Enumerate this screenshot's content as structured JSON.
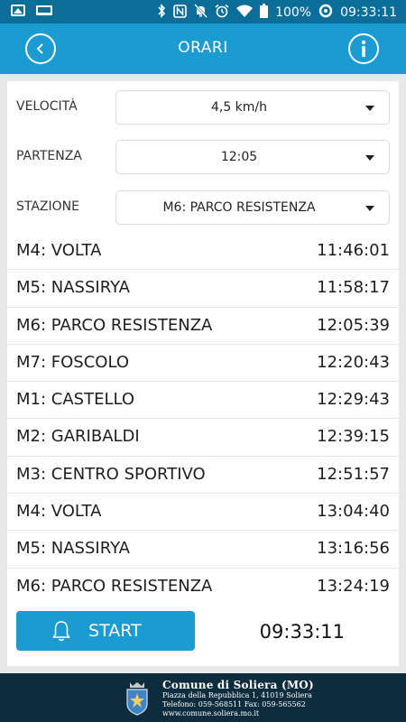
{
  "status_bar": {
    "battery": "100%",
    "time": "09:33:11",
    "left_icons": [
      "image-icon",
      "laptop-icon"
    ],
    "right_icons": [
      "bluetooth-icon",
      "nfc-icon",
      "mute-icon",
      "alarm-icon",
      "wifi-icon",
      "battery-icon",
      "data-saver-icon"
    ]
  },
  "appbar": {
    "title": "ORARI",
    "back_icon": "back-arrow-icon",
    "info_icon": "info-icon"
  },
  "form": {
    "speed_label": "VELOCITÀ",
    "speed_value": "4,5 km/h",
    "departure_label": "PARTENZA",
    "departure_value": "12:05",
    "station_label": "STAZIONE",
    "station_value": "M6: PARCO RESISTENZA"
  },
  "schedule": [
    {
      "stop": "M4: VOLTA",
      "time": "11:46:01"
    },
    {
      "stop": "M5: NASSIRYA",
      "time": "11:58:17"
    },
    {
      "stop": "M6: PARCO RESISTENZA",
      "time": "12:05:39"
    },
    {
      "stop": "M7: FOSCOLO",
      "time": "12:20:43"
    },
    {
      "stop": "M1: CASTELLO",
      "time": "12:29:43"
    },
    {
      "stop": "M2: GARIBALDI",
      "time": "12:39:15"
    },
    {
      "stop": "M3: CENTRO SPORTIVO",
      "time": "12:51:57"
    },
    {
      "stop": "M4: VOLTA",
      "time": "13:04:40"
    },
    {
      "stop": "M5: NASSIRYA",
      "time": "13:16:56"
    },
    {
      "stop": "M6: PARCO RESISTENZA",
      "time": "13:24:19"
    }
  ],
  "start_button": {
    "label": "START",
    "icon": "bell-icon"
  },
  "clock": "09:33:11",
  "footer": {
    "title": "Comune di Soliera (MO)",
    "address": "Piazza della Repubblica 1, 41019 Soliera",
    "phone": "Telefono: 059-568511 Fax: 059-565562",
    "web": "www.comune.soliera.mo.it"
  },
  "colors": {
    "status_bar": "#0b6e99",
    "appbar": "#1a9bd1",
    "button": "#1a9bd1",
    "footer": "#0d2c3d",
    "background": "#e8e8e8"
  }
}
